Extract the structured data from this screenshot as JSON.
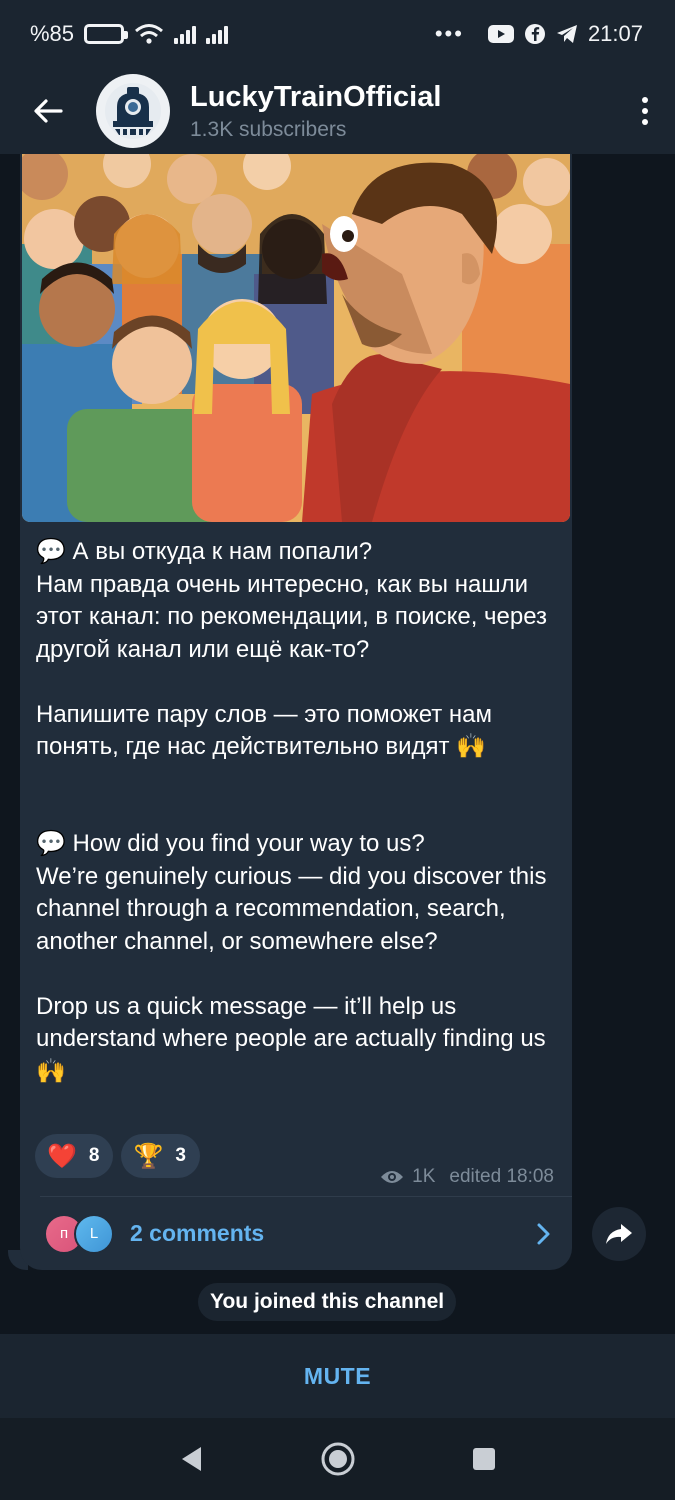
{
  "status_bar": {
    "battery_percent": "%85",
    "time": "21:07",
    "dots": "•••"
  },
  "header": {
    "channel_name": "LuckyTrainOfficial",
    "subscribers": "1.3K subscribers"
  },
  "message": {
    "text_ru": "💬 А вы откуда к нам попали?\nНам правда очень интересно, как вы нашли этот канал: по рекомендации, в поиске, через другой канал или ещё как-то?\n\nНапишите пару слов — это поможет нам понять, где нас действительно видят 🙌",
    "text_en": "💬 How did you find your way to us?\nWe’re genuinely curious — did you discover this channel through a recommendation, search, another channel, or somewhere else?\n\nDrop us a quick message — it’ll help us understand where people are actually finding us 🙌",
    "reactions": [
      {
        "emoji": "❤️",
        "count": "8"
      },
      {
        "emoji": "🏆",
        "count": "3"
      }
    ],
    "views": "1K",
    "edited": "edited 18:08",
    "comment_avatars": [
      "п",
      "L"
    ],
    "comments_label": "2 comments"
  },
  "service_message": "You joined this channel",
  "mute_label": "MUTE",
  "colors": {
    "accent": "#64b4f0",
    "bubble": "#212d3b",
    "header": "#1b2530"
  }
}
